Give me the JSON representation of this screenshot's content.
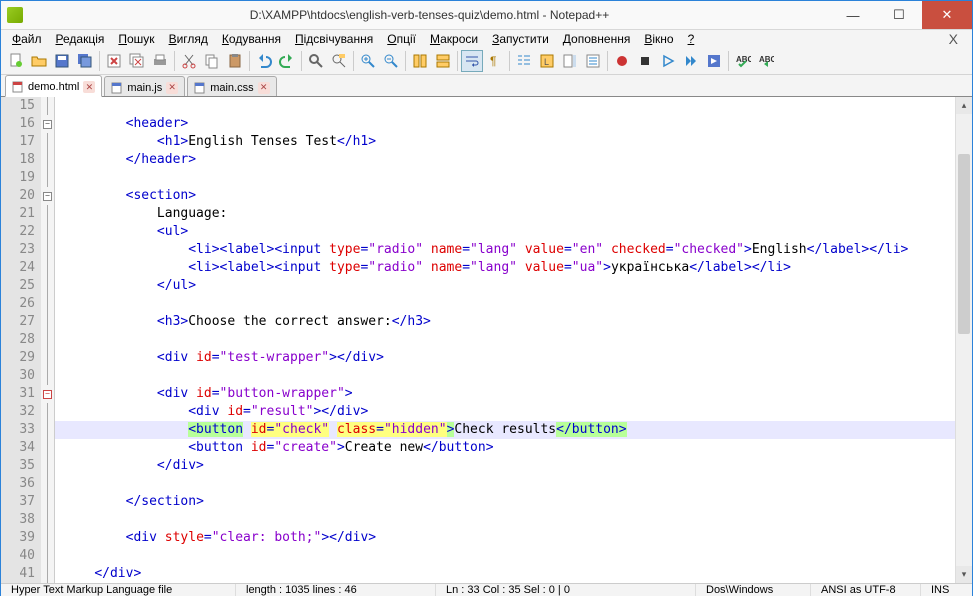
{
  "title": "D:\\XAMPP\\htdocs\\english-verb-tenses-quiz\\demo.html - Notepad++",
  "menus": [
    "Файл",
    "Редакція",
    "Пошук",
    "Вигляд",
    "Кодування",
    "Підсвічування",
    "Опції",
    "Макроси",
    "Запустити",
    "Доповнення",
    "Вікно",
    "?"
  ],
  "tabs": [
    {
      "name": "demo.html",
      "active": true
    },
    {
      "name": "main.js",
      "active": false
    },
    {
      "name": "main.css",
      "active": false
    }
  ],
  "line_start": 15,
  "line_end": 41,
  "highlighted_line": 33,
  "code_lines": [
    {
      "n": 15,
      "fold": "line",
      "html": ""
    },
    {
      "n": 16,
      "fold": "box-",
      "html": "        <span class='tag'>&lt;header&gt;</span>"
    },
    {
      "n": 17,
      "fold": "line",
      "html": "            <span class='tag'>&lt;h1&gt;</span><span class='txt'>English Tenses Test</span><span class='tag'>&lt;/h1&gt;</span>"
    },
    {
      "n": 18,
      "fold": "line",
      "html": "        <span class='tag'>&lt;/header&gt;</span>"
    },
    {
      "n": 19,
      "fold": "line",
      "html": ""
    },
    {
      "n": 20,
      "fold": "box-",
      "html": "        <span class='tag'>&lt;section&gt;</span>"
    },
    {
      "n": 21,
      "fold": "line",
      "html": "            <span class='txt'>Language:</span>"
    },
    {
      "n": 22,
      "fold": "line",
      "html": "            <span class='tag'>&lt;ul&gt;</span>"
    },
    {
      "n": 23,
      "fold": "line",
      "html": "                <span class='tag'>&lt;li&gt;&lt;label&gt;&lt;input</span> <span class='attr'>type</span><span class='tag'>=</span><span class='val'>\"radio\"</span> <span class='attr'>name</span><span class='tag'>=</span><span class='val'>\"lang\"</span> <span class='attr'>value</span><span class='tag'>=</span><span class='val'>\"en\"</span> <span class='attr'>checked</span><span class='tag'>=</span><span class='val'>\"checked\"</span><span class='tag'>&gt;</span><span class='txt'>English</span><span class='tag'>&lt;/label&gt;&lt;/li&gt;</span>"
    },
    {
      "n": 24,
      "fold": "line",
      "html": "                <span class='tag'>&lt;li&gt;&lt;label&gt;&lt;input</span> <span class='attr'>type</span><span class='tag'>=</span><span class='val'>\"radio\"</span> <span class='attr'>name</span><span class='tag'>=</span><span class='val'>\"lang\"</span> <span class='attr'>value</span><span class='tag'>=</span><span class='val'>\"ua\"</span><span class='tag'>&gt;</span><span class='txt'>українська</span><span class='tag'>&lt;/label&gt;&lt;/li&gt;</span>"
    },
    {
      "n": 25,
      "fold": "line",
      "html": "            <span class='tag'>&lt;/ul&gt;</span>"
    },
    {
      "n": 26,
      "fold": "line",
      "html": ""
    },
    {
      "n": 27,
      "fold": "line",
      "html": "            <span class='tag'>&lt;h3&gt;</span><span class='txt'>Choose the correct answer:</span><span class='tag'>&lt;/h3&gt;</span>"
    },
    {
      "n": 28,
      "fold": "line",
      "html": ""
    },
    {
      "n": 29,
      "fold": "line",
      "html": "            <span class='tag'>&lt;div</span> <span class='attr'>id</span><span class='tag'>=</span><span class='val'>\"test-wrapper\"</span><span class='tag'>&gt;&lt;/div&gt;</span>"
    },
    {
      "n": 30,
      "fold": "line",
      "html": ""
    },
    {
      "n": 31,
      "fold": "box-red",
      "html": "            <span class='tag'>&lt;div</span> <span class='attr'>id</span><span class='tag'>=</span><span class='val'>\"button-wrapper\"</span><span class='tag'>&gt;</span>"
    },
    {
      "n": 32,
      "fold": "line",
      "html": "                <span class='tag'>&lt;div</span> <span class='attr'>id</span><span class='tag'>=</span><span class='val'>\"result\"</span><span class='tag'>&gt;&lt;/div&gt;</span>"
    },
    {
      "n": 33,
      "fold": "line",
      "hl": true,
      "html": "                <span class='hlword'><span class='tag'>&lt;button</span></span> <span class='hl-yellow'><span class='attr'>id</span><span class='tag'>=</span><span class='val'>\"check\"</span></span> <span class='hl-yellow'><span class='attr'>class</span><span class='tag'>=</span><span class='val'>\"hidden\"</span></span><span class='hlword'><span class='tag'>&gt;</span></span><span class='txt'>Check results</span><span class='hlword'><span class='tag'>&lt;/button&gt;</span></span>"
    },
    {
      "n": 34,
      "fold": "line",
      "html": "                <span class='tag'>&lt;button</span> <span class='attr'>id</span><span class='tag'>=</span><span class='val'>\"create\"</span><span class='tag'>&gt;</span><span class='txt'>Create new</span><span class='tag'>&lt;/button&gt;</span>"
    },
    {
      "n": 35,
      "fold": "line",
      "html": "            <span class='tag'>&lt;/div&gt;</span>"
    },
    {
      "n": 36,
      "fold": "line",
      "html": ""
    },
    {
      "n": 37,
      "fold": "line",
      "html": "        <span class='tag'>&lt;/section&gt;</span>"
    },
    {
      "n": 38,
      "fold": "line",
      "html": ""
    },
    {
      "n": 39,
      "fold": "line",
      "html": "        <span class='tag'>&lt;div</span> <span class='attr'>style</span><span class='tag'>=</span><span class='val'>\"clear: both;\"</span><span class='tag'>&gt;&lt;/div&gt;</span>"
    },
    {
      "n": 40,
      "fold": "line",
      "html": ""
    },
    {
      "n": 41,
      "fold": "line",
      "html": "    <span class='tag'>&lt;/div&gt;</span>"
    }
  ],
  "status": {
    "filetype": "Hyper Text Markup Language file",
    "length": "length : 1035    lines : 46",
    "pos": "Ln : 33    Col : 35    Sel : 0 | 0",
    "eol": "Dos\\Windows",
    "enc": "ANSI as UTF-8",
    "ins": "INS"
  }
}
